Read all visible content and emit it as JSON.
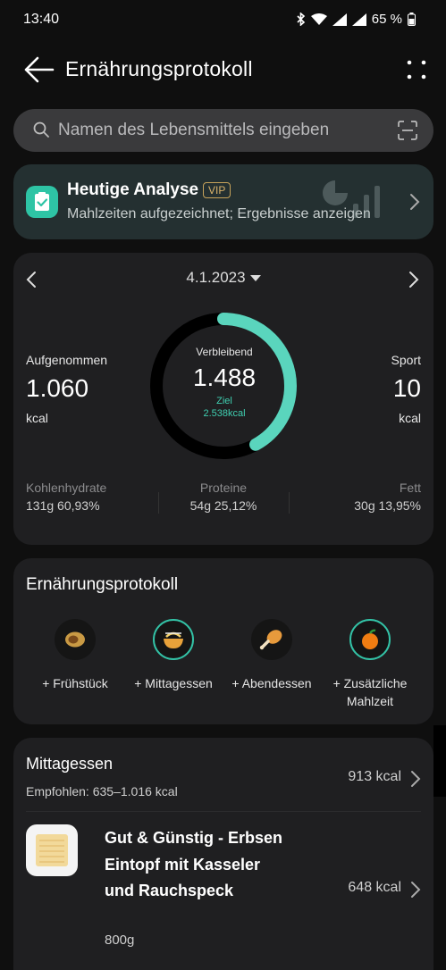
{
  "status_bar": {
    "time": "13:40",
    "battery": "65 %"
  },
  "header": {
    "title": "Ernährungsprotokoll"
  },
  "search": {
    "placeholder": "Namen des Lebensmittels eingeben"
  },
  "analysis": {
    "title": "Heutige Analyse",
    "badge": "VIP",
    "subtitle": "Mahlzeiten aufgezeichnet; Ergebnisse anzeigen"
  },
  "summary": {
    "date": "4.1.2023",
    "consumed": {
      "label": "Aufgenommen",
      "value": "1.060",
      "unit": "kcal"
    },
    "remaining": {
      "label": "Verbleibend",
      "value": "1.488",
      "goal_label": "Ziel",
      "goal_value": "2.538kcal"
    },
    "sport": {
      "label": "Sport",
      "value": "10",
      "unit": "kcal"
    },
    "ring_progress": 0.42,
    "macros": [
      {
        "name": "Kohlenhydrate",
        "value": "131g 60,93%"
      },
      {
        "name": "Proteine",
        "value": "54g 25,12%"
      },
      {
        "name": "Fett",
        "value": "30g 13,95%"
      }
    ]
  },
  "log": {
    "title": "Ernährungsprotokoll",
    "meals": [
      {
        "label": "+ Frühstück",
        "icon": "fried-egg-icon"
      },
      {
        "label": "+ Mittagessen",
        "icon": "noodle-bowl-icon"
      },
      {
        "label": "+ Abendessen",
        "icon": "chicken-leg-icon"
      },
      {
        "label": "+ Zusätzliche\nMahlzeit",
        "label_line1": "+ Zusätzliche",
        "label_line2": "Mahlzeit",
        "icon": "orange-icon"
      }
    ]
  },
  "lunch": {
    "title": "Mittagessen",
    "recommended": "Empfohlen: 635–1.016 kcal",
    "total": "913 kcal",
    "item": {
      "name": "Gut & Günstig - Erbsen Eintopf mit Kasseler und Rauchspeck",
      "amount": "800g",
      "kcal": "648 kcal"
    }
  },
  "colors": {
    "accent": "#3fcfb1",
    "card": "#1f1f21",
    "background": "#0f0f0f"
  }
}
